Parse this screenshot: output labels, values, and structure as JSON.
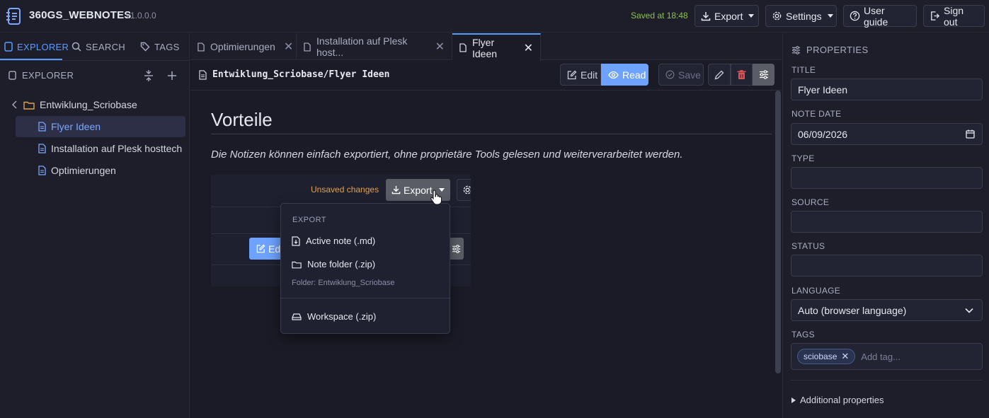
{
  "app": {
    "name": "360GS_WEBNOTES",
    "version": "v1.0.0.0"
  },
  "topbar": {
    "saved_status": "Saved at 18:48",
    "export_label": "Export",
    "settings_label": "Settings",
    "user_guide_label": "User guide",
    "sign_out_label": "Sign out"
  },
  "sidebar": {
    "tabs": [
      {
        "label": "EXPLORER",
        "icon": "file-icon",
        "active": true
      },
      {
        "label": "SEARCH",
        "icon": "search-icon"
      },
      {
        "label": "TAGS",
        "icon": "tag-icon"
      }
    ],
    "section_title": "EXPLORER",
    "tree": {
      "folder": "Entwiklung_Scriobase",
      "items": [
        {
          "label": "Flyer Ideen",
          "selected": true
        },
        {
          "label": "Installation auf Plesk hosttech"
        },
        {
          "label": "Optimierungen"
        }
      ]
    }
  },
  "editor": {
    "tabs": [
      {
        "label": "Optimierungen"
      },
      {
        "label": "Installation auf Plesk host..."
      },
      {
        "label": "Flyer Ideen",
        "active": true
      }
    ],
    "path": "Entwiklung_Scriobase/Flyer Ideen",
    "toolbar": {
      "edit_label": "Edit",
      "read_label": "Read",
      "save_label": "Save"
    },
    "content": {
      "heading": "Vorteile",
      "paragraph": "Die Notizen können einfach exportiert, ohne proprietäre Tools gelesen und weiterverarbeitet werden."
    },
    "embedded_screenshot": {
      "unsaved_label": "Unsaved changes",
      "export_label": "Export",
      "edit_label_partial": "Edi"
    }
  },
  "export_menu": {
    "header": "EXPORT",
    "items": [
      {
        "label": "Active note (.md)",
        "icon": "file-down-icon"
      },
      {
        "label": "Note folder (.zip)",
        "icon": "folder-icon"
      },
      {
        "label": "Workspace (.zip)",
        "icon": "drive-icon"
      }
    ],
    "folder_hint": "Folder: Entwiklung_Scriobase"
  },
  "properties": {
    "title": "PROPERTIES",
    "fields": {
      "title_label": "TITLE",
      "title_value": "Flyer Ideen",
      "date_label": "NOTE DATE",
      "date_value": "06/09/2026",
      "type_label": "TYPE",
      "type_value": "",
      "source_label": "SOURCE",
      "source_value": "",
      "status_label": "STATUS",
      "status_value": "",
      "language_label": "LANGUAGE",
      "language_value": "Auto (browser language)",
      "tags_label": "TAGS",
      "tags": [
        "sciobase"
      ],
      "tag_placeholder": "Add tag..."
    },
    "additional_label": "Additional properties"
  },
  "colors": {
    "accent": "#5b9cff",
    "saved": "#8bc34a",
    "unsaved": "#e0a04a",
    "delete": "#e05252"
  }
}
